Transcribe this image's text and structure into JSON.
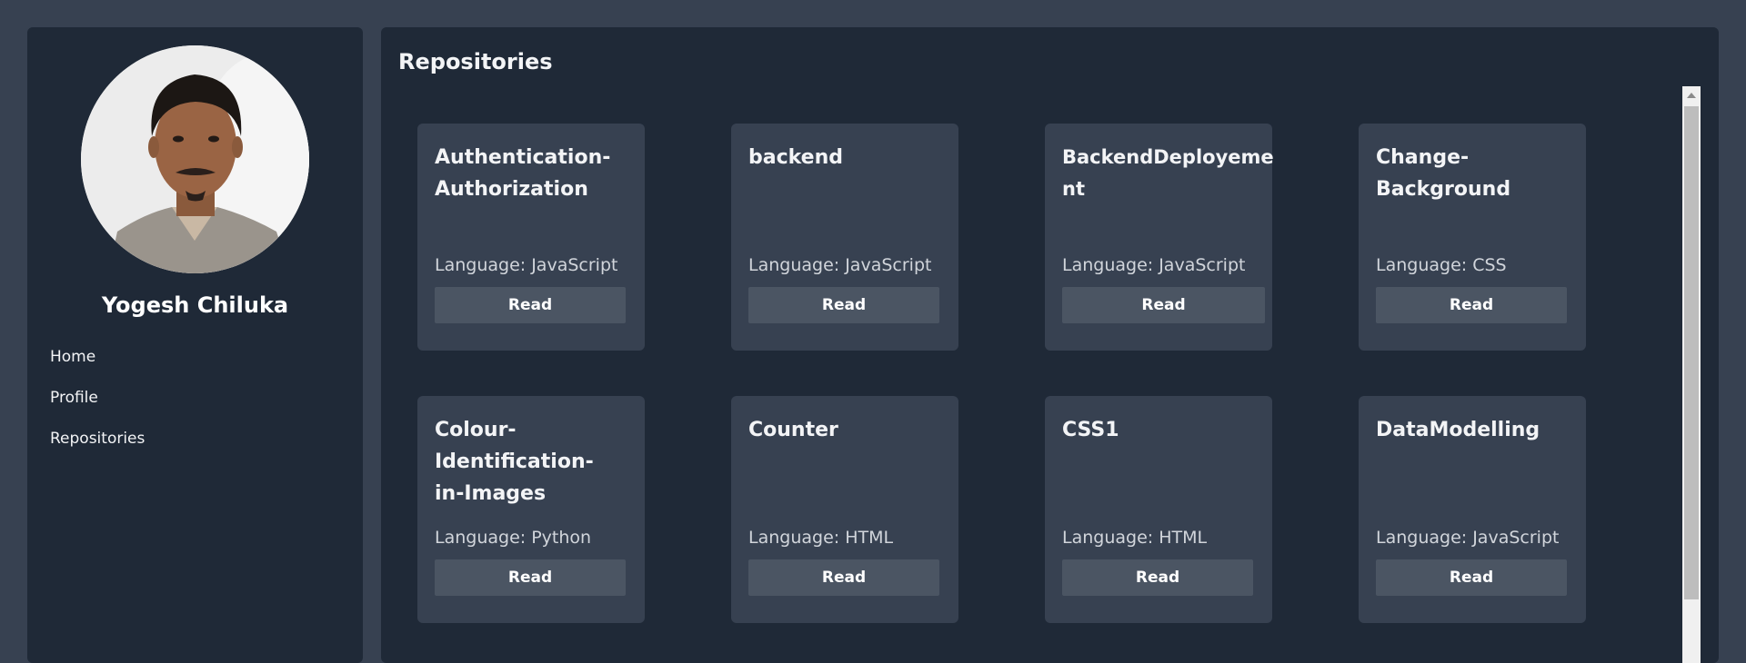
{
  "sidebar": {
    "user_name": "Yogesh Chiluka",
    "nav": [
      {
        "label": "Home"
      },
      {
        "label": "Profile"
      },
      {
        "label": "Repositories"
      }
    ]
  },
  "main": {
    "title": "Repositories",
    "repos": [
      {
        "name": "Authentication-Authorization",
        "language": "Language: JavaScript",
        "button": "Read"
      },
      {
        "name": "backend",
        "language": "Language: JavaScript",
        "button": "Read"
      },
      {
        "name": "BackendDeployement",
        "language": "Language: JavaScript",
        "button": "Read"
      },
      {
        "name": "Change-Background",
        "language": "Language: CSS",
        "button": "Read"
      },
      {
        "name": "Colour-Identification-in-Images",
        "language": "Language: Python",
        "button": "Read"
      },
      {
        "name": "Counter",
        "language": "Language: HTML",
        "button": "Read"
      },
      {
        "name": "CSS1",
        "language": "Language: HTML",
        "button": "Read"
      },
      {
        "name": "DataModelling",
        "language": "Language: JavaScript",
        "button": "Read"
      }
    ]
  },
  "colors": {
    "page_bg": "#374151",
    "panel_bg": "#1f2937",
    "card_bg": "#374151",
    "button_bg": "#4b5563"
  }
}
